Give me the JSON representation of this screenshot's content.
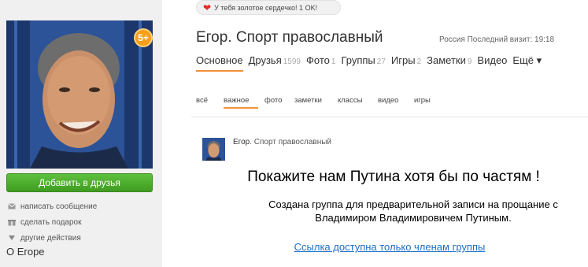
{
  "notification": {
    "text": "У тебя золотое сердечко! 1 OK!"
  },
  "profile": {
    "name": "Егор. Спорт православный",
    "country": "Россия",
    "last_visit": "Последний визит: 19:18",
    "badge": "5+"
  },
  "left": {
    "add_friend": "Добавить в друзья",
    "actions": [
      "написать сообщение",
      "сделать подарок",
      "другие действия"
    ],
    "about": "О Егоре"
  },
  "tabs": [
    {
      "label": "Основное",
      "count": ""
    },
    {
      "label": "Друзья",
      "count": "1599"
    },
    {
      "label": "Фото",
      "count": "1"
    },
    {
      "label": "Группы",
      "count": "27"
    },
    {
      "label": "Игры",
      "count": "2"
    },
    {
      "label": "Заметки",
      "count": "9"
    },
    {
      "label": "Видео",
      "count": ""
    },
    {
      "label": "Ещё ▾",
      "count": ""
    }
  ],
  "subtabs": [
    "всё",
    "важное",
    "фото",
    "заметки",
    "классы",
    "видео",
    "игры"
  ],
  "post": {
    "author_first": "Егор",
    "author_rest": ". Спорт православный",
    "headline": "Покажите нам Путина хотя бы по частям !",
    "body": "Создана группа для предварительной записи на прощание с Владимиром Владимировичем Путиным.",
    "link": "Ссылка доступна только членам группы"
  },
  "colors": {
    "accent": "#f2913a",
    "button_green": "#4bab2a",
    "link_blue": "#1a6fc7",
    "heart_red": "#e62c2c"
  }
}
